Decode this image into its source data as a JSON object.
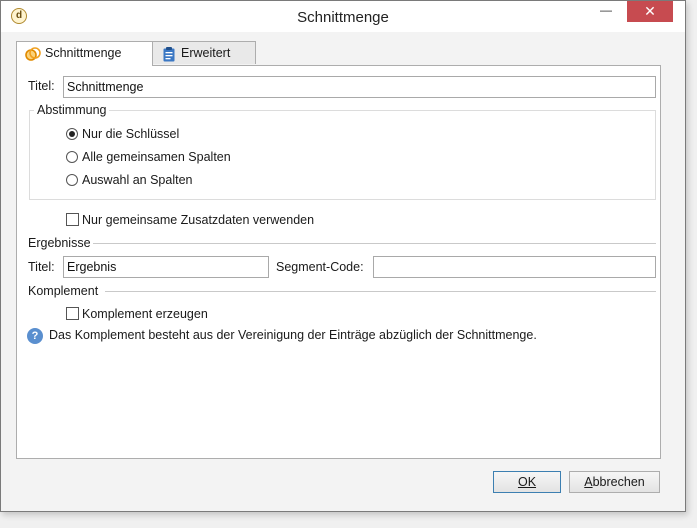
{
  "window": {
    "title": "Schnittmenge",
    "minimize_glyph": "—",
    "close_glyph": "✕",
    "app_icon": "app-logo-icon"
  },
  "tabs": [
    {
      "label": "Schnittmenge",
      "icon": "intersection-icon",
      "active": true
    },
    {
      "label": "Erweitert",
      "icon": "clipboard-icon",
      "active": false
    }
  ],
  "form": {
    "title_label": "Titel:",
    "title_value": "Schnittmenge",
    "abstimmung": {
      "legend": "Abstimmung",
      "options": [
        {
          "label": "Nur die Schlüssel",
          "checked": true
        },
        {
          "label": "Alle gemeinsamen Spalten",
          "checked": false
        },
        {
          "label": "Auswahl an Spalten",
          "checked": false
        }
      ]
    },
    "shared_data_checkbox": {
      "label": "Nur gemeinsame Zusatzdaten verwenden",
      "checked": false
    },
    "ergebnisse": {
      "heading": "Ergebnisse",
      "title_label": "Titel:",
      "title_value": "Ergebnis",
      "segment_label": "Segment-Code:",
      "segment_value": ""
    },
    "komplement": {
      "heading": "Komplement",
      "checkbox_label": "Komplement erzeugen",
      "checked": false,
      "help_text": "Das Komplement besteht aus der Vereinigung der Einträge abzüglich der Schnittmenge."
    }
  },
  "buttons": {
    "ok": "OK",
    "cancel_first": "A",
    "cancel_rest": "bbrechen"
  },
  "colors": {
    "close_button": "#c74b50",
    "help_icon": "#5a8fcf",
    "tab_icon_orange": "#f0a020",
    "tab_icon_blue": "#3b78c4"
  }
}
